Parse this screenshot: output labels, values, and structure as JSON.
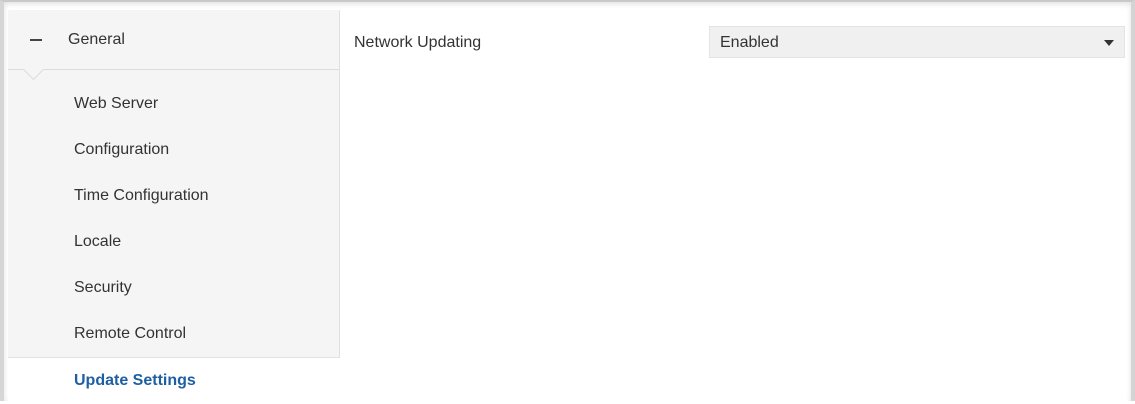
{
  "sidebar": {
    "group": {
      "label": "General",
      "icon": "minus-icon"
    },
    "items": [
      {
        "label": "Web Server",
        "active": false
      },
      {
        "label": "Configuration",
        "active": false
      },
      {
        "label": "Time Configuration",
        "active": false
      },
      {
        "label": "Locale",
        "active": false
      },
      {
        "label": "Security",
        "active": false
      },
      {
        "label": "Remote Control",
        "active": false
      },
      {
        "label": "Update Settings",
        "active": true
      }
    ]
  },
  "main": {
    "field": {
      "label": "Network Updating",
      "value": "Enabled",
      "icon": "chevron-down-icon"
    }
  },
  "colors": {
    "active_text": "#1e5fa3",
    "sidebar_bg": "#f5f5f5",
    "select_bg": "#f0f0f0"
  }
}
